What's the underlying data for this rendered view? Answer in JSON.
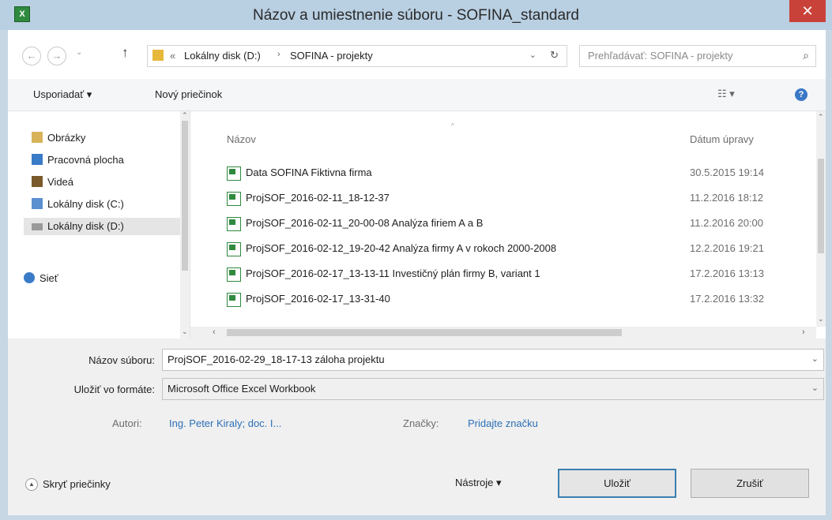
{
  "window": {
    "title": "Názov a umiestnenie súboru  -  SOFINA_standard",
    "close": "✕"
  },
  "nav": {
    "back": "←",
    "forward": "→",
    "recent": "⌄",
    "up": "↑"
  },
  "address": {
    "prefix": "«",
    "segments": [
      "Lokálny disk (D:)",
      "SOFINA - projekty"
    ],
    "sep": "›",
    "dropdown": "⌄",
    "refresh": "↻"
  },
  "search": {
    "placeholder": "Prehľadávať: SOFINA - projekty",
    "icon": "⌕"
  },
  "toolbar": {
    "organize": "Usporiadať ▾",
    "new_folder": "Nový priečinok",
    "view": "☷ ▾",
    "help": "?"
  },
  "sidebar": {
    "items": [
      {
        "label": "Obrázky",
        "icon": "pictures-icon",
        "color": "#d8b35a"
      },
      {
        "label": "Pracovná plocha",
        "icon": "desktop-icon",
        "color": "#3a7bc8"
      },
      {
        "label": "Videá",
        "icon": "videos-icon",
        "color": "#7a5a2a"
      },
      {
        "label": "Lokálny disk (C:)",
        "icon": "drive-c-icon",
        "color": "#5a8fd0"
      },
      {
        "label": "Lokálny disk (D:)",
        "icon": "drive-d-icon",
        "color": "#9a9a9a"
      },
      {
        "label": "Sieť",
        "icon": "network-icon",
        "color": "#3a7bc8"
      }
    ]
  },
  "files": {
    "col_name": "Názov",
    "col_date": "Dátum úpravy",
    "rows": [
      {
        "name": "Data SOFINA Fiktivna firma",
        "date": "30.5.2015 19:14"
      },
      {
        "name": "ProjSOF_2016-02-11_18-12-37",
        "date": "11.2.2016 18:12"
      },
      {
        "name": "ProjSOF_2016-02-11_20-00-08 Analýza firiem A a B",
        "date": "11.2.2016 20:00"
      },
      {
        "name": "ProjSOF_2016-02-12_19-20-42 Analýza firmy A v rokoch 2000-2008",
        "date": "12.2.2016 19:21"
      },
      {
        "name": "ProjSOF_2016-02-17_13-13-11 Investičný plán firmy B, variant 1",
        "date": "17.2.2016 13:13"
      },
      {
        "name": "ProjSOF_2016-02-17_13-31-40",
        "date": "17.2.2016 13:32"
      }
    ]
  },
  "form": {
    "filename_label": "Názov súboru:",
    "filename_value": "ProjSOF_2016-02-29_18-17-13 záloha projektu",
    "format_label": "Uložiť vo formáte:",
    "format_value": "Microsoft Office Excel Workbook",
    "authors_label": "Autori:",
    "authors_value": "Ing. Peter Kiraly; doc. I...",
    "tags_label": "Značky:",
    "tags_value": "Pridajte značku"
  },
  "footer": {
    "hide_folders": "Skryť priečinky",
    "tools": "Nástroje ▾",
    "save": "Uložiť",
    "cancel": "Zrušiť"
  },
  "colors": {
    "title_bg": "#b9cfe2",
    "close_bg": "#c9423a",
    "link": "#2b6fb6"
  }
}
